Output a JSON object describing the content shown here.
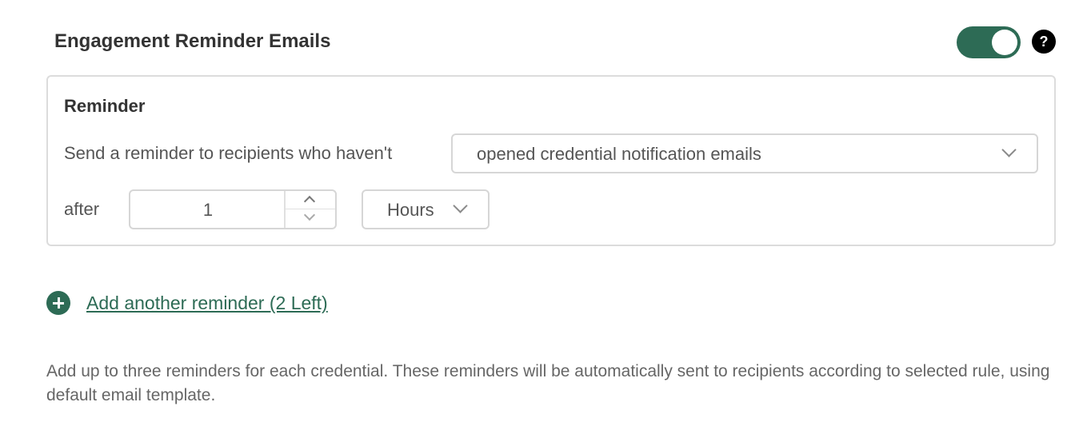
{
  "header": {
    "title": "Engagement Reminder Emails",
    "toggle_on": true,
    "help_glyph": "?"
  },
  "reminder_card": {
    "title": "Reminder",
    "send_label": "Send a reminder to recipients who haven't",
    "condition_value": "opened credential notification emails",
    "after_label": "after",
    "quantity_value": "1",
    "unit_value": "Hours"
  },
  "add_reminder": {
    "label": "Add another reminder (2 Left)"
  },
  "description": "Add up to three reminders for each credential. These reminders will be automatically sent to recipients according to selected rule, using default email template.",
  "colors": {
    "accent": "#2d6b55",
    "text": "#333333",
    "muted": "#666666",
    "border": "#d6d6d6"
  },
  "icons": [
    "plus-circle-icon",
    "help-icon",
    "chevron-down-icon",
    "chevron-up-icon"
  ]
}
